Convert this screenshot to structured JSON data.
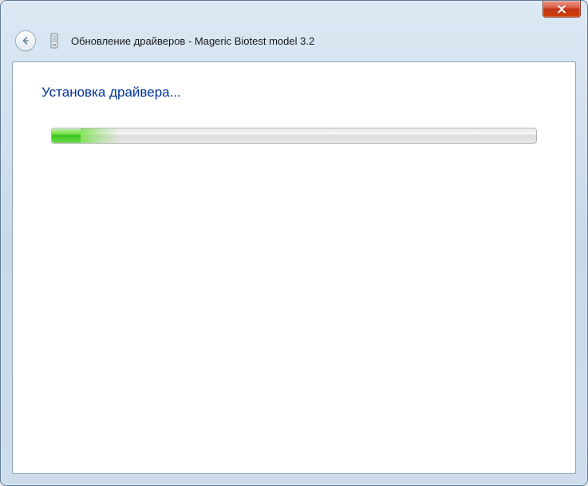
{
  "window": {
    "title": "Обновление драйверов - Mageric Biotest model 3.2"
  },
  "content": {
    "heading": "Установка драйвера...",
    "progress_percent": 6,
    "progress_fade_start": 6,
    "progress_fade_width": 8
  }
}
